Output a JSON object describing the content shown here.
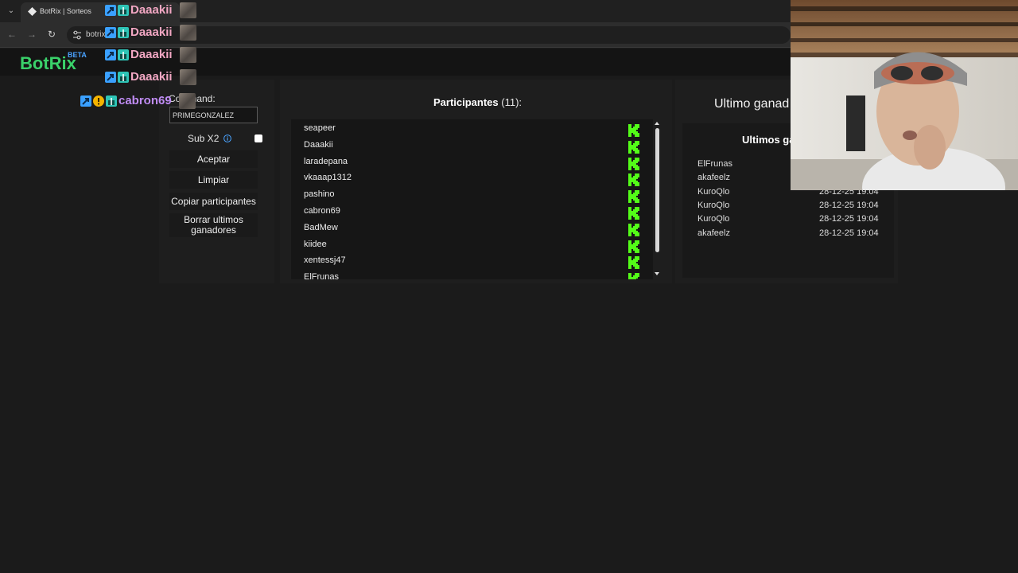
{
  "browser": {
    "tab_title": "BotRix | Sorteos",
    "url_text": "botrix"
  },
  "site": {
    "logo_text": "BotRix",
    "beta_label": "BETA"
  },
  "left_panel": {
    "command_label": "Command:",
    "command_value": "PRIMEGONZALEZ",
    "sub_label": "Sub X2",
    "sub_checked": false,
    "buttons": {
      "accept": "Aceptar",
      "clear": "Limpiar",
      "copy": "Copiar participantes",
      "delete_line1": "Borrar ultimos",
      "delete_line2": "ganadores"
    }
  },
  "participants": {
    "title": "Participantes",
    "count": "(11):",
    "platform_icon": "kick-icon",
    "items": [
      "seapeer",
      "Daaakii",
      "laradepana",
      "vkaaap1312",
      "pashino",
      "cabron69",
      "BadMew",
      "kiidee",
      "xentessj47",
      "ElFrunas"
    ]
  },
  "winners": {
    "last_winner_title": "Ultimo ganad",
    "list_title": "Ultimos ga",
    "rows": [
      {
        "name": "ElFrunas",
        "date": ""
      },
      {
        "name": "akafeelz",
        "date": ""
      },
      {
        "name": "KuroQlo",
        "date": "28-12-25 19:04"
      },
      {
        "name": "KuroQlo",
        "date": "28-12-25 19:04"
      },
      {
        "name": "KuroQlo",
        "date": "28-12-25 19:04"
      },
      {
        "name": "akafeelz",
        "date": "28-12-25 19:04"
      }
    ]
  },
  "chat_overlay": [
    {
      "name": "Daaakii",
      "color": "#f2a7c3"
    },
    {
      "name": "Daaakii",
      "color": "#f2a7c3"
    },
    {
      "name": "Daaakii",
      "color": "#f2a7c3"
    },
    {
      "name": "Daaakii",
      "color": "#f2a7c3"
    },
    {
      "name": "cabron69",
      "color": "#c08cf5"
    }
  ],
  "colors": {
    "brand_green": "#3ad16a",
    "kick_green": "#53fc18",
    "beta_blue": "#4aa3ff"
  }
}
